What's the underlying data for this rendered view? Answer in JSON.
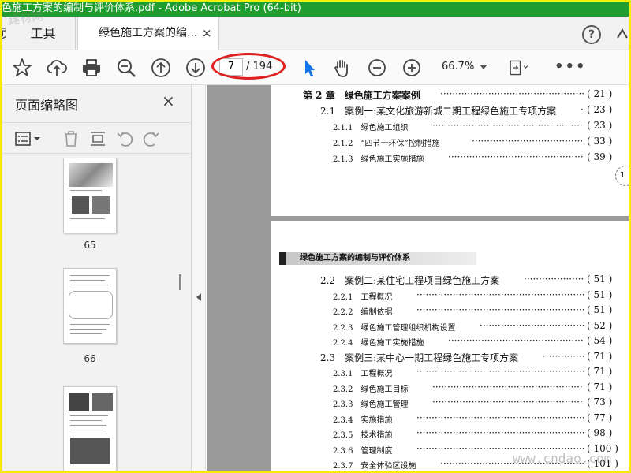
{
  "window": {
    "title": "色施工方案的编制与评价体系.pdf - Adobe Acrobat Pro (64-bit)",
    "title_bar_color": "#1f9d2f",
    "frame_color": "#f4ee00"
  },
  "tabs": {
    "home_stub": "页",
    "tools": "工具",
    "document": "绿色施工方案的编...",
    "close": "×"
  },
  "topright": {
    "help_icon": "help-circle-icon",
    "scroll_icon": "scroll-up-icon"
  },
  "toolbar": {
    "icons": [
      "star-icon",
      "cloud-upload-icon",
      "printer-icon",
      "zoom-search-icon",
      "page-up-icon",
      "page-down-icon",
      "select-cursor-icon",
      "hand-tool-icon",
      "zoom-out-icon",
      "zoom-in-icon",
      "fit-page-icon",
      "more-icon"
    ],
    "current_page": "7",
    "total_pages": "/ 194",
    "zoom": "66.7%",
    "more": "•••",
    "highlight_color": "#e02020",
    "accent_color": "#1473e6"
  },
  "left_panel": {
    "title": "页面缩略图",
    "close": "×",
    "tool_icons": [
      "options-list-icon",
      "delete-icon",
      "insert-page-icon",
      "rotate-left-icon",
      "rotate-right-icon"
    ],
    "thumbnails": [
      {
        "label": "65"
      },
      {
        "label": "66"
      },
      {
        "label": ""
      }
    ]
  },
  "document": {
    "page1_toc": [
      {
        "level": 0,
        "text": "第 2 章　绿色施工方案案例",
        "page": "( 21 )"
      },
      {
        "level": 1,
        "text": "2.1　案例一:某文化旅游新城二期工程绿色施工专项方案",
        "page": "( 23 )"
      },
      {
        "level": 2,
        "text": "2.1.1　绿色施工组织",
        "page": "( 23 )"
      },
      {
        "level": 2,
        "text": "2.1.2　“四节一环保”控制措施",
        "page": "( 33 )"
      },
      {
        "level": 2,
        "text": "2.1.3　绿色施工实施措施",
        "page": "( 39 )"
      }
    ],
    "page2_header": "绿色施工方案的编制与评价体系",
    "page2_toc": [
      {
        "level": 1,
        "text": "2.2　案例二:某住宅工程项目绿色施工方案",
        "page": "( 51 )"
      },
      {
        "level": 2,
        "text": "2.2.1　工程概况",
        "page": "( 51 )"
      },
      {
        "level": 2,
        "text": "2.2.2　编制依据",
        "page": "( 51 )"
      },
      {
        "level": 2,
        "text": "2.2.3　绿色施工管理组织机构设置",
        "page": "( 52 )"
      },
      {
        "level": 2,
        "text": "2.2.4　绿色施工实施措施",
        "page": "( 54 )"
      },
      {
        "level": 1,
        "text": "2.3　案例三:某中心一期工程绿色施工专项方案",
        "page": "( 71 )"
      },
      {
        "level": 2,
        "text": "2.3.1　工程概况",
        "page": "( 71 )"
      },
      {
        "level": 2,
        "text": "2.3.2　绿色施工目标",
        "page": "( 71 )"
      },
      {
        "level": 2,
        "text": "2.3.3　绿色施工管理",
        "page": "( 73 )"
      },
      {
        "level": 2,
        "text": "2.3.4　实施措施",
        "page": "( 77 )"
      },
      {
        "level": 2,
        "text": "2.3.5　技术措施",
        "page": "( 98 )"
      },
      {
        "level": 2,
        "text": "2.3.6　管理制度",
        "page": "( 100 )"
      },
      {
        "level": 2,
        "text": "2.3.7　安全体验区设施",
        "page": "( 101 )"
      }
    ],
    "edge_marker": "1"
  },
  "watermarks": {
    "top": "建材网",
    "bottom": "www.cndao.com"
  }
}
